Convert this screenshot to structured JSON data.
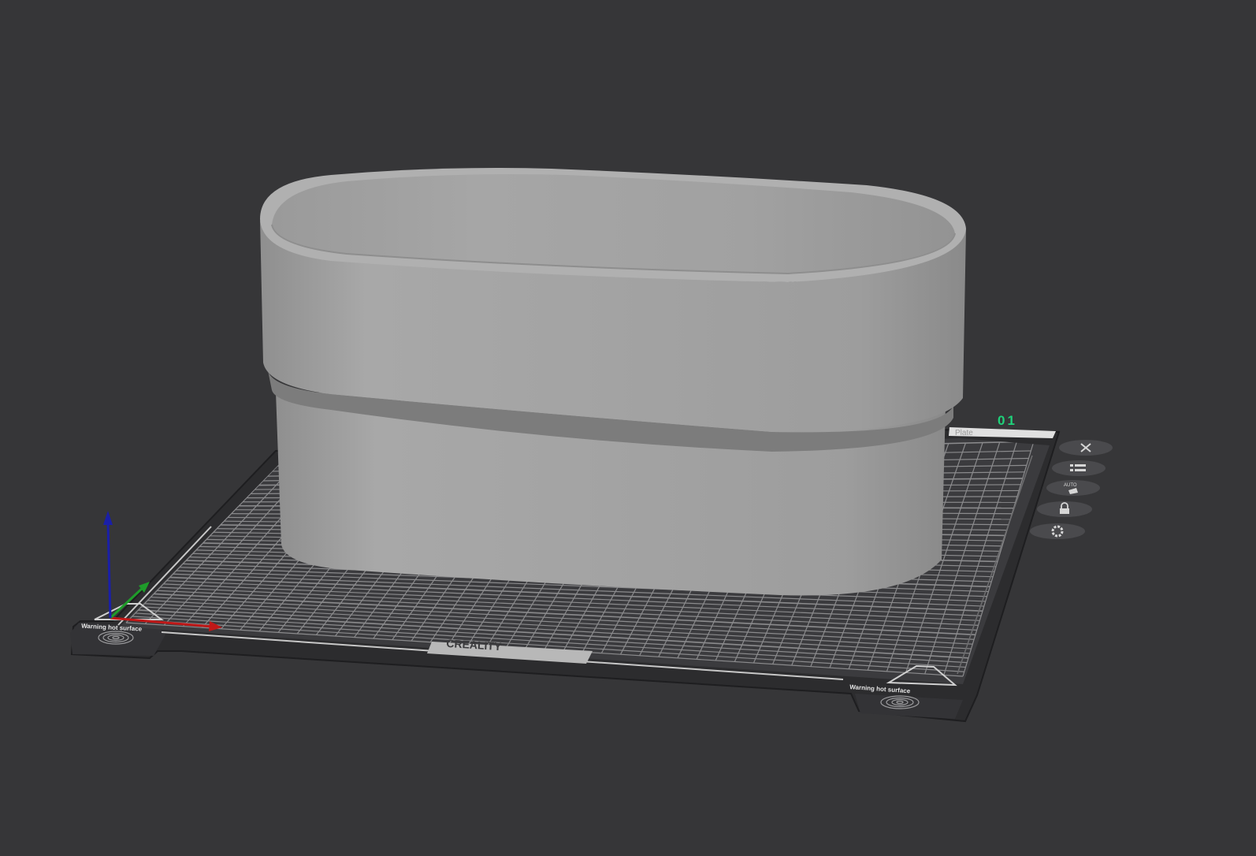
{
  "viewport": {
    "background": "#363638"
  },
  "plate": {
    "number": "01",
    "name_label": "Plate",
    "brand": "CREALITY",
    "warning_left": "Warning hot surface",
    "warning_right": "Warning hot surface",
    "number_color": "#1fd17a"
  },
  "plate_toolbar": {
    "buttons": [
      {
        "name": "remove-plate-button",
        "icon": "close-icon"
      },
      {
        "name": "arrange-button",
        "icon": "list-icon"
      },
      {
        "name": "auto-orient-button",
        "icon": "auto-orient-icon",
        "label": "AUTO"
      },
      {
        "name": "lock-plate-button",
        "icon": "lock-icon"
      },
      {
        "name": "plate-settings-button",
        "icon": "gear-icon"
      }
    ]
  },
  "model": {
    "color": "#a3a3a3",
    "shape": "oval container"
  },
  "axes": {
    "x_color": "#c01818",
    "y_color": "#1f9c2a",
    "z_color": "#1a1fa8"
  }
}
